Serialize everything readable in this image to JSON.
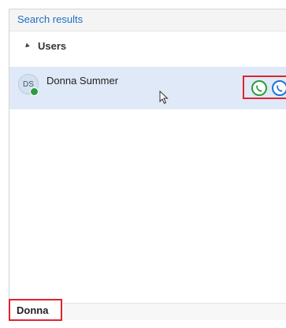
{
  "results": {
    "title": "Search results",
    "group": {
      "label": "Users",
      "expanded": true
    },
    "contacts": [
      {
        "initials": "DS",
        "name": "Donna Summer",
        "presence": "available",
        "presence_color": "#2c9c42",
        "actions": [
          {
            "name": "audio-call",
            "icon": "phone-circle-icon",
            "color": "#2a9d3b"
          },
          {
            "name": "video-call",
            "icon": "phone-circle-icon",
            "color": "#1c74d4"
          }
        ]
      }
    ]
  },
  "search": {
    "value": "Donna"
  },
  "colors": {
    "accent": "#1e6fc4",
    "highlight_border": "#e0242c",
    "selected_row": "#dfe9f7"
  }
}
